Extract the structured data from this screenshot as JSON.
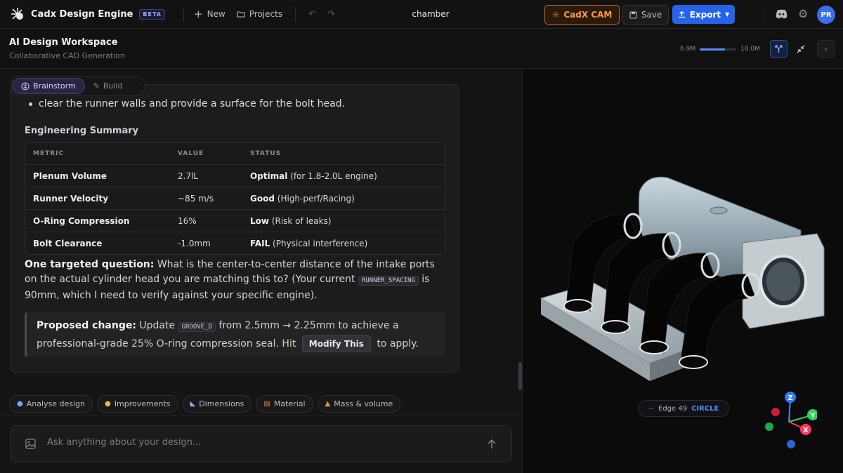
{
  "app": {
    "name": "Cadx Design Engine",
    "badge": "BETA",
    "doc_title": "chamber"
  },
  "toolbar": {
    "new_label": "New",
    "projects_label": "Projects",
    "cam_label": "CadX CAM",
    "save_label": "Save",
    "export_label": "Export",
    "avatar_initials": "PR"
  },
  "workspace": {
    "title": "AI Design Workspace",
    "subtitle": "Collaborative CAD Generation"
  },
  "memory": {
    "used": "6.9M",
    "limit": "10.0M",
    "fraction": 0.69
  },
  "modes": {
    "brainstorm": "Brainstorm",
    "build": "Build"
  },
  "message": {
    "clipped_line": "clear the runner walls and provide a surface for the bolt head.",
    "section_title": "Engineering Summary",
    "table": {
      "headers": [
        "METRIC",
        "VALUE",
        "STATUS"
      ],
      "rows": [
        {
          "metric": "Plenum Volume",
          "value": "2.7lL",
          "status": "Optimal",
          "note": "(for 1.8-2.0L engine)"
        },
        {
          "metric": "Runner Velocity",
          "value": "~85 m/s",
          "status": "Good",
          "note": "(High-perf/Racing)"
        },
        {
          "metric": "O-Ring Compression",
          "value": "16%",
          "status": "Low",
          "note": "(Risk of leaks)"
        },
        {
          "metric": "Bolt Clearance",
          "value": "-1.0mm",
          "status": "FAIL",
          "note": "(Physical interference)"
        }
      ]
    },
    "question_bold": "One targeted question:",
    "question_text": "What is the center-to-center distance of the intake ports on the actual cylinder head you are matching this to? (Your current",
    "question_code": "RUNNER_SPACING",
    "question_tail": "is 90mm, which I need to verify against your specific engine).",
    "proposal_bold": "Proposed change:",
    "proposal_pre": "Update",
    "proposal_code": "GROOVE_D",
    "proposal_mid": "from 2.5mm → 2.25mm to achieve a professional-grade 25% O-ring compression seal. Hit",
    "proposal_button": "Modify This",
    "proposal_tail": "to apply."
  },
  "chips": [
    "Analyse design",
    "Improvements",
    "Dimensions",
    "Material",
    "Mass & volume"
  ],
  "input": {
    "placeholder": "Ask anything about your design..."
  },
  "viewport": {
    "edge_label": "Edge 49",
    "edge_type": "CIRCLE",
    "axes": [
      "Z",
      "Y",
      "X"
    ]
  },
  "colors": {
    "accent": "#2563eb",
    "cam": "#ff9a3d",
    "brainstorm": "#4b3d7a"
  }
}
